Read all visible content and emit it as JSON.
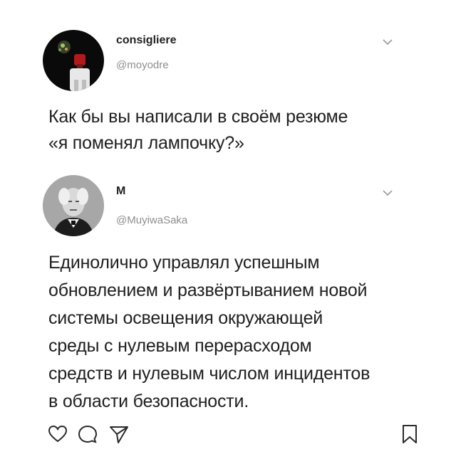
{
  "tweet1": {
    "name": "consigliere",
    "handle": "@moyodre",
    "text": "Как бы вы написали в своём резюме\n«я поменял лампочку?»"
  },
  "tweet2": {
    "name": "M",
    "handle": "@MuyiwaSaka",
    "text": "Единолично управлял успешным\nобновлением и развёртыванием новой\nсистемы освещения окружающей\nсреды с нулевым перерасходом\nсредств и нулевым числом инцидентов\nв области безопасности."
  },
  "actions": {
    "icons": [
      "heart-icon",
      "comment-icon",
      "share-icon",
      "bookmark-icon"
    ]
  }
}
